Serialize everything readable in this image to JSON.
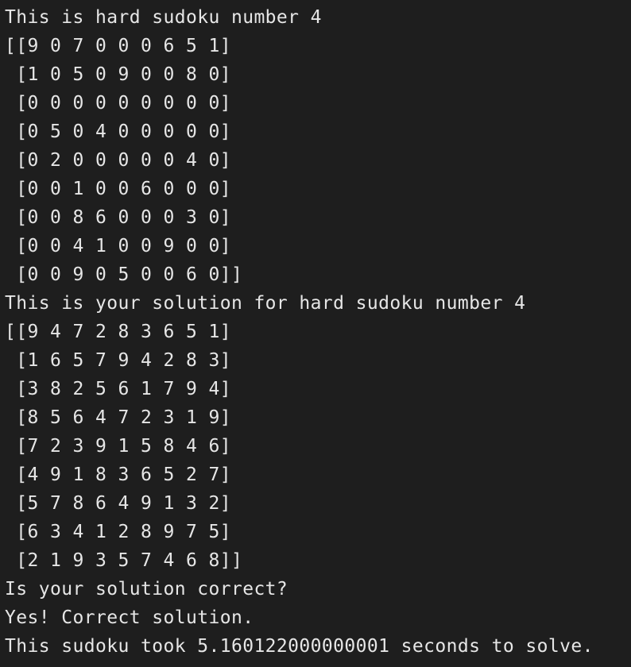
{
  "terminal": {
    "lines": [
      "This is hard sudoku number 4",
      "[[9 0 7 0 0 0 6 5 1]",
      " [1 0 5 0 9 0 0 8 0]",
      " [0 0 0 0 0 0 0 0 0]",
      " [0 5 0 4 0 0 0 0 0]",
      " [0 2 0 0 0 0 0 4 0]",
      " [0 0 1 0 0 6 0 0 0]",
      " [0 0 8 6 0 0 0 3 0]",
      " [0 0 4 1 0 0 9 0 0]",
      " [0 0 9 0 5 0 0 6 0]]",
      "This is your solution for hard sudoku number 4",
      "[[9 4 7 2 8 3 6 5 1]",
      " [1 6 5 7 9 4 2 8 3]",
      " [3 8 2 5 6 1 7 9 4]",
      " [8 5 6 4 7 2 3 1 9]",
      " [7 2 3 9 1 5 8 4 6]",
      " [4 9 1 8 3 6 5 2 7]",
      " [5 7 8 6 4 9 1 3 2]",
      " [6 3 4 1 2 8 9 7 5]",
      " [2 1 9 3 5 7 4 6 8]]",
      "Is your solution correct?",
      "Yes! Correct solution.",
      "This sudoku took 5.160122000000001 seconds to solve."
    ]
  }
}
